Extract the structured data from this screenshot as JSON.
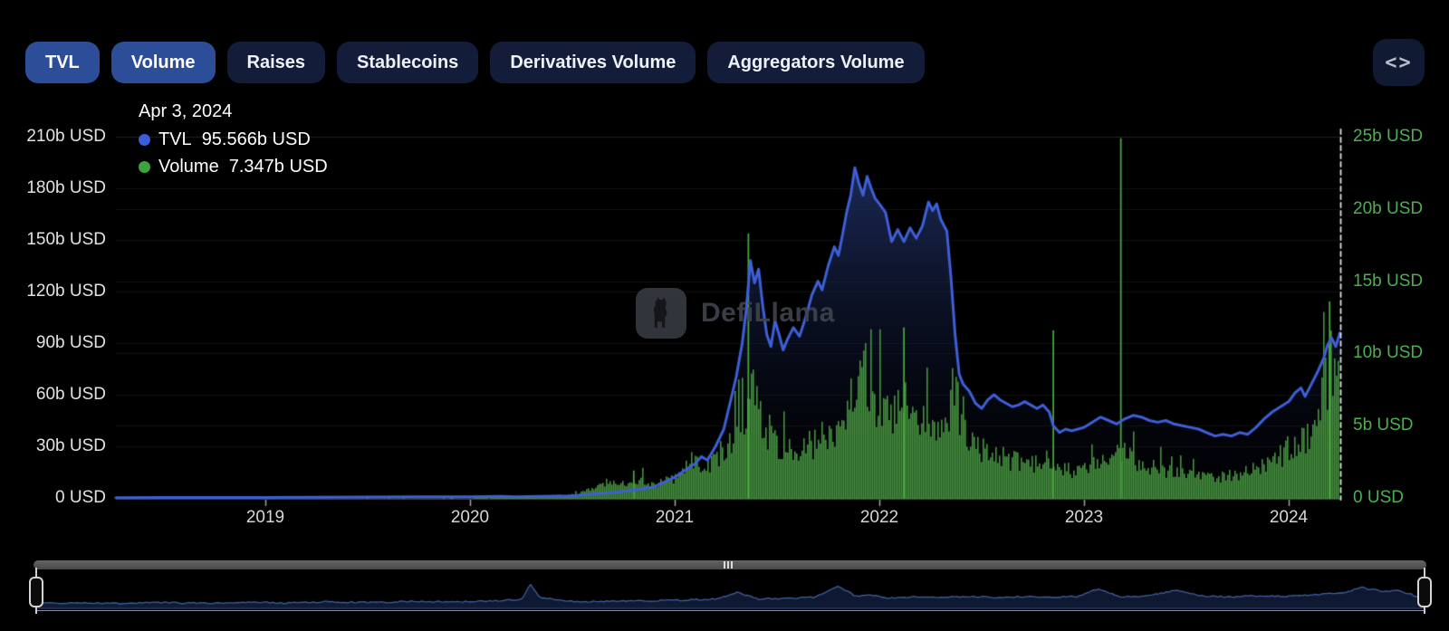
{
  "toolbar": {
    "buttons": [
      {
        "label": "TVL",
        "active": true
      },
      {
        "label": "Volume",
        "active": true
      },
      {
        "label": "Raises",
        "active": false
      },
      {
        "label": "Stablecoins",
        "active": false
      },
      {
        "label": "Derivatives Volume",
        "active": false
      },
      {
        "label": "Aggregators Volume",
        "active": false
      }
    ],
    "code_button_icon": "<>"
  },
  "legend": {
    "date": "Apr 3, 2024",
    "items": [
      {
        "label": "TVL",
        "value": "95.566b USD",
        "color": "#3d5cdb"
      },
      {
        "label": "Volume",
        "value": "7.347b USD",
        "color": "#3da43d"
      }
    ]
  },
  "watermark": {
    "text": "DefiLlama"
  },
  "colors": {
    "tvl_line": "#3e5fd7",
    "volume_bar": "#3f9737",
    "right_axis_text": "#4caf50",
    "active_tab": "#2c4d97",
    "inactive_tab": "#131d3a",
    "background": "#000000"
  },
  "chart_data": {
    "type": "mixed",
    "title": "TVL and Volume over time",
    "x_axis": {
      "range": [
        2018.27,
        2024.26
      ],
      "ticks": [
        {
          "v": 2019,
          "label": "2019"
        },
        {
          "v": 2020,
          "label": "2020"
        },
        {
          "v": 2021,
          "label": "2021"
        },
        {
          "v": 2022,
          "label": "2022"
        },
        {
          "v": 2023,
          "label": "2023"
        },
        {
          "v": 2024,
          "label": "2024"
        }
      ]
    },
    "left_axis": {
      "min": 0,
      "max": 210,
      "unit": "b USD",
      "ticks": [
        {
          "v": 0,
          "label": "0 USD"
        },
        {
          "v": 30,
          "label": "30b USD"
        },
        {
          "v": 60,
          "label": "60b USD"
        },
        {
          "v": 90,
          "label": "90b USD"
        },
        {
          "v": 120,
          "label": "120b USD"
        },
        {
          "v": 150,
          "label": "150b USD"
        },
        {
          "v": 180,
          "label": "180b USD"
        },
        {
          "v": 210,
          "label": "210b USD"
        }
      ]
    },
    "right_axis": {
      "min": 0,
      "max": 25,
      "unit": "b USD",
      "ticks": [
        {
          "v": 0,
          "label": "0 USD"
        },
        {
          "v": 5,
          "label": "5b USD"
        },
        {
          "v": 10,
          "label": "10b USD"
        },
        {
          "v": 15,
          "label": "15b USD"
        },
        {
          "v": 20,
          "label": "20b USD"
        },
        {
          "v": 25,
          "label": "25b USD"
        }
      ]
    },
    "series": [
      {
        "name": "TVL",
        "type": "line",
        "axis": "left",
        "unit": "b USD",
        "points": [
          [
            2018.27,
            0.15
          ],
          [
            2018.5,
            0.2
          ],
          [
            2018.75,
            0.25
          ],
          [
            2019,
            0.3
          ],
          [
            2019.25,
            0.4
          ],
          [
            2019.5,
            0.5
          ],
          [
            2019.75,
            0.6
          ],
          [
            2020,
            0.7
          ],
          [
            2020.15,
            0.9
          ],
          [
            2020.22,
            0.6
          ],
          [
            2020.35,
            0.9
          ],
          [
            2020.5,
            1.2
          ],
          [
            2020.6,
            2.2
          ],
          [
            2020.7,
            3.2
          ],
          [
            2020.8,
            4.5
          ],
          [
            2020.9,
            6.5
          ],
          [
            2021,
            12
          ],
          [
            2021.05,
            16
          ],
          [
            2021.1,
            20
          ],
          [
            2021.13,
            24
          ],
          [
            2021.16,
            22
          ],
          [
            2021.2,
            30
          ],
          [
            2021.24,
            40
          ],
          [
            2021.27,
            55
          ],
          [
            2021.3,
            70
          ],
          [
            2021.33,
            90
          ],
          [
            2021.35,
            110
          ],
          [
            2021.37,
            138
          ],
          [
            2021.39,
            125
          ],
          [
            2021.41,
            133
          ],
          [
            2021.43,
            112
          ],
          [
            2021.45,
            95
          ],
          [
            2021.47,
            88
          ],
          [
            2021.49,
            103
          ],
          [
            2021.51,
            95
          ],
          [
            2021.53,
            86
          ],
          [
            2021.55,
            92
          ],
          [
            2021.58,
            99
          ],
          [
            2021.61,
            94
          ],
          [
            2021.64,
            105
          ],
          [
            2021.67,
            118
          ],
          [
            2021.7,
            126
          ],
          [
            2021.72,
            121
          ],
          [
            2021.75,
            135
          ],
          [
            2021.78,
            146
          ],
          [
            2021.8,
            141
          ],
          [
            2021.82,
            153
          ],
          [
            2021.84,
            166
          ],
          [
            2021.86,
            176
          ],
          [
            2021.88,
            192
          ],
          [
            2021.9,
            183
          ],
          [
            2021.92,
            176
          ],
          [
            2021.94,
            187
          ],
          [
            2021.96,
            180
          ],
          [
            2021.98,
            174
          ],
          [
            2022,
            171
          ],
          [
            2022.03,
            166
          ],
          [
            2022.06,
            149
          ],
          [
            2022.09,
            156
          ],
          [
            2022.12,
            149
          ],
          [
            2022.15,
            157
          ],
          [
            2022.18,
            151
          ],
          [
            2022.21,
            158
          ],
          [
            2022.24,
            172
          ],
          [
            2022.26,
            167
          ],
          [
            2022.28,
            171
          ],
          [
            2022.3,
            162
          ],
          [
            2022.33,
            155
          ],
          [
            2022.35,
            128
          ],
          [
            2022.37,
            95
          ],
          [
            2022.39,
            72
          ],
          [
            2022.41,
            66
          ],
          [
            2022.44,
            62
          ],
          [
            2022.47,
            55
          ],
          [
            2022.5,
            52
          ],
          [
            2022.53,
            57
          ],
          [
            2022.56,
            60
          ],
          [
            2022.59,
            57
          ],
          [
            2022.62,
            55
          ],
          [
            2022.65,
            53
          ],
          [
            2022.68,
            54
          ],
          [
            2022.71,
            56
          ],
          [
            2022.74,
            54
          ],
          [
            2022.77,
            52
          ],
          [
            2022.8,
            54
          ],
          [
            2022.83,
            50
          ],
          [
            2022.85,
            42
          ],
          [
            2022.88,
            38
          ],
          [
            2022.91,
            40
          ],
          [
            2022.94,
            39
          ],
          [
            2022.97,
            40
          ],
          [
            2023,
            41
          ],
          [
            2023.04,
            44
          ],
          [
            2023.08,
            47
          ],
          [
            2023.12,
            45
          ],
          [
            2023.16,
            43
          ],
          [
            2023.2,
            46
          ],
          [
            2023.24,
            48
          ],
          [
            2023.28,
            47
          ],
          [
            2023.32,
            45
          ],
          [
            2023.36,
            44
          ],
          [
            2023.4,
            45
          ],
          [
            2023.44,
            43
          ],
          [
            2023.48,
            42
          ],
          [
            2023.52,
            41
          ],
          [
            2023.56,
            40
          ],
          [
            2023.6,
            38
          ],
          [
            2023.64,
            36
          ],
          [
            2023.68,
            37
          ],
          [
            2023.72,
            36
          ],
          [
            2023.76,
            38
          ],
          [
            2023.8,
            37
          ],
          [
            2023.84,
            41
          ],
          [
            2023.88,
            46
          ],
          [
            2023.92,
            50
          ],
          [
            2023.96,
            53
          ],
          [
            2024,
            56
          ],
          [
            2024.03,
            61
          ],
          [
            2024.06,
            64
          ],
          [
            2024.08,
            59
          ],
          [
            2024.11,
            66
          ],
          [
            2024.14,
            73
          ],
          [
            2024.17,
            81
          ],
          [
            2024.19,
            89
          ],
          [
            2024.21,
            93
          ],
          [
            2024.23,
            88
          ],
          [
            2024.25,
            96
          ],
          [
            2024.26,
            95.566
          ]
        ]
      },
      {
        "name": "Volume",
        "type": "bar",
        "axis": "right",
        "unit": "b USD",
        "envelope": [
          [
            2018.27,
            0.02
          ],
          [
            2019.5,
            0.03
          ],
          [
            2020,
            0.05
          ],
          [
            2020.3,
            0.1
          ],
          [
            2020.5,
            0.3
          ],
          [
            2020.6,
            0.8
          ],
          [
            2020.66,
            1.4
          ],
          [
            2020.72,
            1.1
          ],
          [
            2020.8,
            1.7
          ],
          [
            2020.9,
            1.2
          ],
          [
            2021,
            1.8
          ],
          [
            2021.05,
            2.6
          ],
          [
            2021.1,
            3.2
          ],
          [
            2021.15,
            2.8
          ],
          [
            2021.2,
            3.4
          ],
          [
            2021.25,
            4.2
          ],
          [
            2021.3,
            5.2
          ],
          [
            2021.33,
            6.5
          ],
          [
            2021.36,
            9.2
          ],
          [
            2021.4,
            8.2
          ],
          [
            2021.44,
            6.4
          ],
          [
            2021.48,
            5.2
          ],
          [
            2021.52,
            4.2
          ],
          [
            2021.56,
            3.8
          ],
          [
            2021.6,
            4.1
          ],
          [
            2021.65,
            4.6
          ],
          [
            2021.7,
            5.2
          ],
          [
            2021.75,
            5.8
          ],
          [
            2021.8,
            6.6
          ],
          [
            2021.84,
            8.2
          ],
          [
            2021.88,
            10.4
          ],
          [
            2021.91,
            13.2
          ],
          [
            2021.94,
            10.2
          ],
          [
            2021.97,
            8.8
          ],
          [
            2022,
            8.2
          ],
          [
            2022.04,
            7.2
          ],
          [
            2022.08,
            7.6
          ],
          [
            2022.12,
            8.4
          ],
          [
            2022.16,
            7
          ],
          [
            2022.2,
            6.4
          ],
          [
            2022.25,
            6.8
          ],
          [
            2022.3,
            6.2
          ],
          [
            2022.33,
            6.6
          ],
          [
            2022.36,
            9.8
          ],
          [
            2022.4,
            6.4
          ],
          [
            2022.44,
            5.2
          ],
          [
            2022.48,
            4.4
          ],
          [
            2022.52,
            4.2
          ],
          [
            2022.56,
            3.9
          ],
          [
            2022.6,
            3.6
          ],
          [
            2022.65,
            3.3
          ],
          [
            2022.7,
            3.1
          ],
          [
            2022.75,
            2.9
          ],
          [
            2022.8,
            3.2
          ],
          [
            2022.83,
            3.6
          ],
          [
            2022.87,
            3.2
          ],
          [
            2022.9,
            2.7
          ],
          [
            2022.95,
            2.4
          ],
          [
            2023,
            2.6
          ],
          [
            2023.05,
            2.9
          ],
          [
            2023.1,
            3.2
          ],
          [
            2023.15,
            3.6
          ],
          [
            2023.2,
            4.4
          ],
          [
            2023.25,
            3.4
          ],
          [
            2023.3,
            3
          ],
          [
            2023.35,
            2.7
          ],
          [
            2023.4,
            2.5
          ],
          [
            2023.45,
            2.4
          ],
          [
            2023.5,
            2.2
          ],
          [
            2023.55,
            2.1
          ],
          [
            2023.6,
            2
          ],
          [
            2023.65,
            1.9
          ],
          [
            2023.7,
            2
          ],
          [
            2023.75,
            2.2
          ],
          [
            2023.8,
            2.4
          ],
          [
            2023.85,
            2.7
          ],
          [
            2023.9,
            3.1
          ],
          [
            2023.95,
            3.6
          ],
          [
            2024,
            4.2
          ],
          [
            2024.04,
            4.8
          ],
          [
            2024.08,
            5.6
          ],
          [
            2024.12,
            6.6
          ],
          [
            2024.15,
            8
          ],
          [
            2024.18,
            10.5
          ],
          [
            2024.2,
            12.5
          ],
          [
            2024.22,
            11
          ],
          [
            2024.24,
            12
          ],
          [
            2024.26,
            7.347
          ]
        ],
        "spikes": [
          [
            2020.8,
            1.9
          ],
          [
            2021.36,
            18.3
          ],
          [
            2022.12,
            11.8
          ],
          [
            2022.85,
            11.6
          ],
          [
            2023.18,
            24.9
          ],
          [
            2024.2,
            13.6
          ]
        ]
      }
    ],
    "crosshair_x": 2024.26,
    "minimap": {
      "points": [
        [
          0,
          0.1
        ],
        [
          0.03,
          0.12
        ],
        [
          0.06,
          0.1
        ],
        [
          0.09,
          0.13
        ],
        [
          0.12,
          0.11
        ],
        [
          0.15,
          0.14
        ],
        [
          0.18,
          0.12
        ],
        [
          0.21,
          0.15
        ],
        [
          0.24,
          0.13
        ],
        [
          0.27,
          0.16
        ],
        [
          0.3,
          0.15
        ],
        [
          0.33,
          0.17
        ],
        [
          0.35,
          0.22
        ],
        [
          0.356,
          0.62
        ],
        [
          0.362,
          0.28
        ],
        [
          0.38,
          0.17
        ],
        [
          0.4,
          0.15
        ],
        [
          0.43,
          0.17
        ],
        [
          0.46,
          0.19
        ],
        [
          0.49,
          0.22
        ],
        [
          0.505,
          0.4
        ],
        [
          0.52,
          0.22
        ],
        [
          0.54,
          0.24
        ],
        [
          0.56,
          0.27
        ],
        [
          0.578,
          0.55
        ],
        [
          0.59,
          0.3
        ],
        [
          0.6,
          0.33
        ],
        [
          0.615,
          0.25
        ],
        [
          0.63,
          0.28
        ],
        [
          0.65,
          0.26
        ],
        [
          0.67,
          0.29
        ],
        [
          0.69,
          0.26
        ],
        [
          0.71,
          0.28
        ],
        [
          0.73,
          0.27
        ],
        [
          0.75,
          0.29
        ],
        [
          0.765,
          0.5
        ],
        [
          0.78,
          0.28
        ],
        [
          0.8,
          0.3
        ],
        [
          0.82,
          0.45
        ],
        [
          0.84,
          0.3
        ],
        [
          0.86,
          0.28
        ],
        [
          0.88,
          0.31
        ],
        [
          0.9,
          0.29
        ],
        [
          0.92,
          0.33
        ],
        [
          0.94,
          0.38
        ],
        [
          0.955,
          0.52
        ],
        [
          0.97,
          0.42
        ],
        [
          0.98,
          0.45
        ],
        [
          0.99,
          0.35
        ],
        [
          1,
          0.22
        ]
      ]
    }
  }
}
